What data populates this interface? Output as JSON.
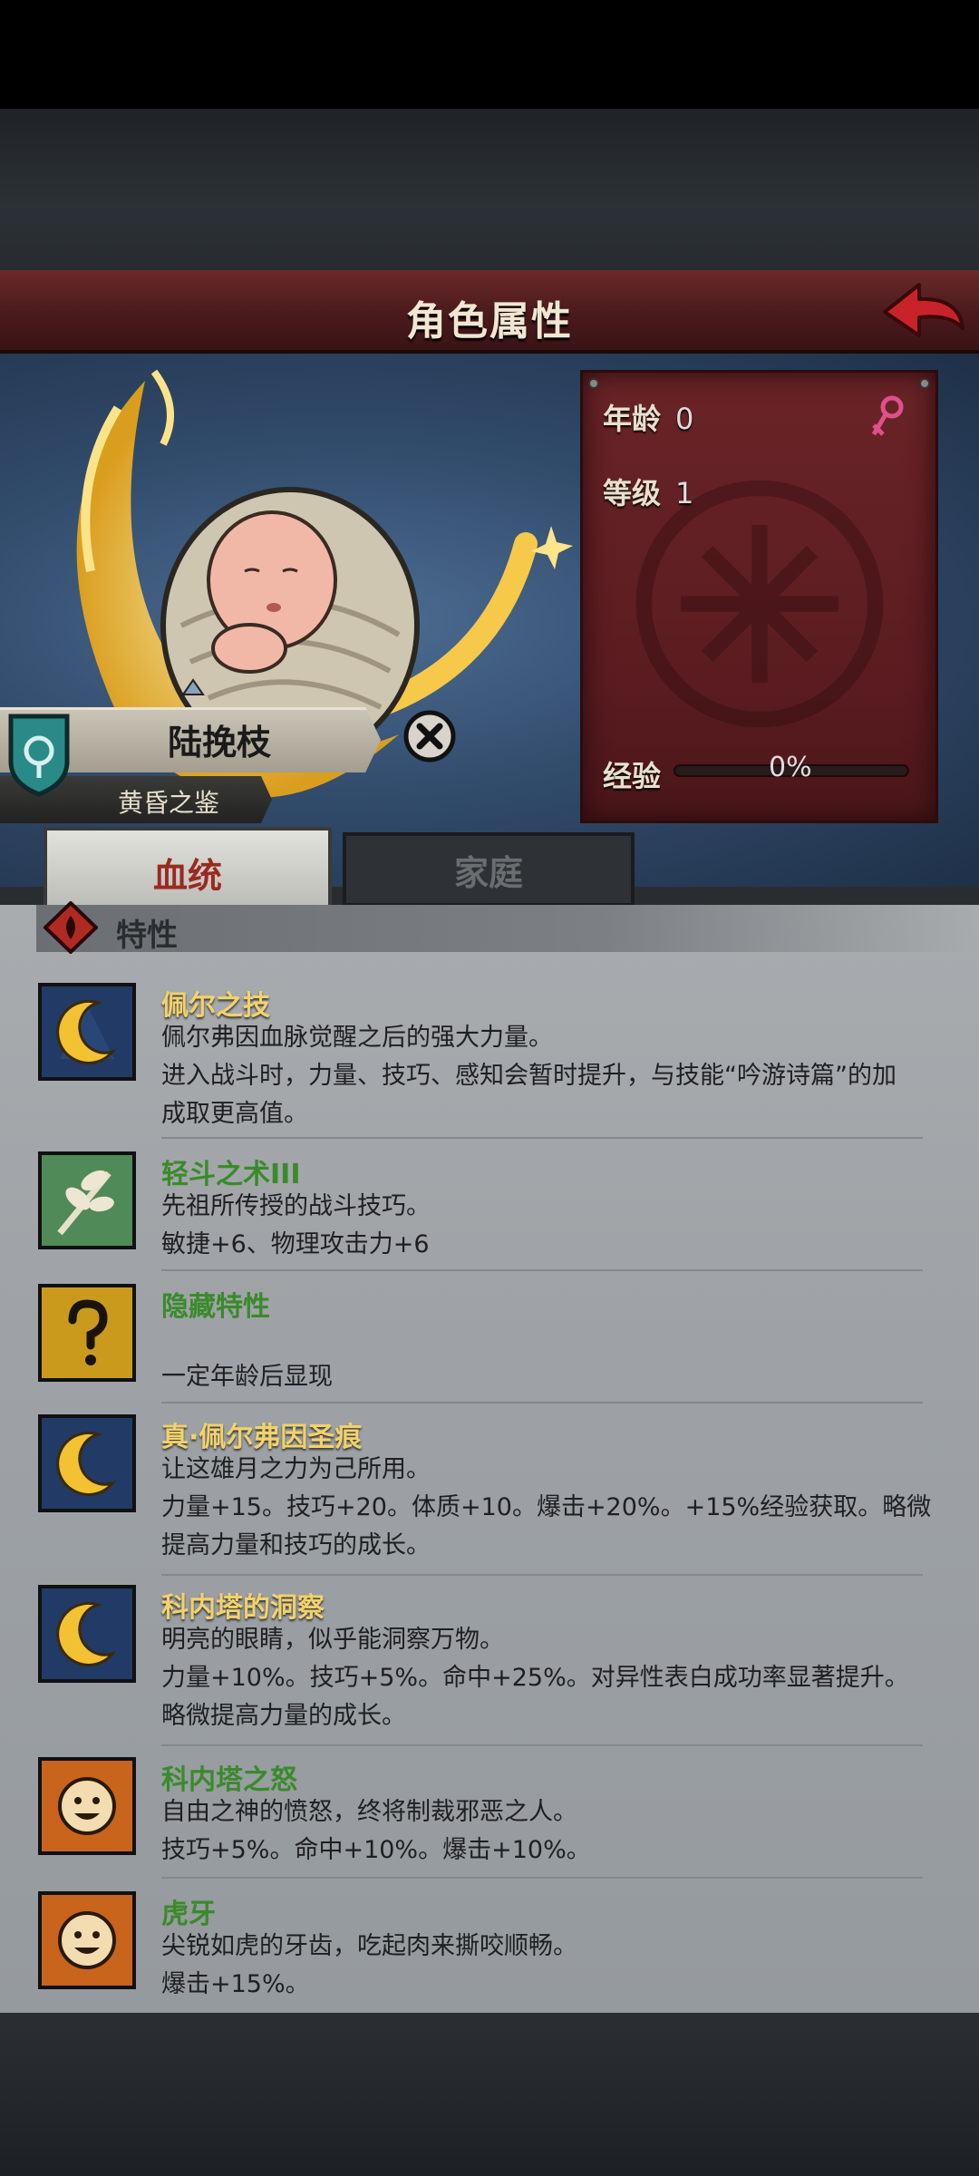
{
  "header": {
    "title": "角色属性"
  },
  "character": {
    "name": "陆挽枝",
    "subtitle": "黄昏之鉴",
    "stats": {
      "age_label": "年龄",
      "age_value": "0",
      "level_label": "等级",
      "level_value": "1",
      "exp_label": "经验",
      "exp_value": "0%",
      "exp_fraction": 0
    }
  },
  "tabs": [
    {
      "label": "血统",
      "active": true
    },
    {
      "label": "家庭",
      "active": false
    }
  ],
  "traits_section": {
    "title": "特性"
  },
  "traits": [
    {
      "name": "佩尔之技",
      "color": "gold",
      "icon": "crescent-moon-icon",
      "lines": [
        "佩尔弗因血脉觉醒之后的强大力量。",
        "进入战斗时，力量、技巧、感知会暂时提升，与技能“吟游诗篇”的加",
        "成取更高值。"
      ]
    },
    {
      "name": "轻斗之术III",
      "color": "green",
      "icon": "leaf-branch-icon",
      "lines": [
        "先祖所传授的战斗技巧。",
        "敏捷+6、物理攻击力+6"
      ]
    },
    {
      "name": "隐藏特性",
      "color": "green",
      "icon": "question-mark-icon",
      "lines": [
        "",
        "一定年龄后显现"
      ]
    },
    {
      "name": "真·佩尔弗因圣痕",
      "color": "gold",
      "icon": "crescent-moon-icon",
      "lines": [
        "让这雄月之力为己所用。",
        "力量+15。技巧+20。体质+10。爆击+20%。+15%经验获取。略微",
        "提高力量和技巧的成长。"
      ]
    },
    {
      "name": "科内塔的洞察",
      "color": "gold",
      "icon": "crescent-moon-icon",
      "lines": [
        "明亮的眼睛，似乎能洞察万物。",
        "力量+10%。技巧+5%。命中+25%。对异性表白成功率显著提升。",
        "略微提高力量的成长。"
      ]
    },
    {
      "name": "科内塔之怒",
      "color": "green",
      "icon": "sun-face-icon",
      "lines": [
        "自由之神的愤怒，终将制裁邪恶之人。",
        "技巧+5%。命中+10%。爆击+10%。"
      ]
    },
    {
      "name": "虎牙",
      "color": "green",
      "icon": "sun-face-icon",
      "lines": [
        "尖锐如虎的牙齿，吃起肉来撕咬顺畅。",
        "爆击+15%。"
      ]
    }
  ],
  "colors": {
    "gold_name": "#f2d26a",
    "green_name": "#3a8a2a",
    "banner": "#4a1a1c"
  }
}
